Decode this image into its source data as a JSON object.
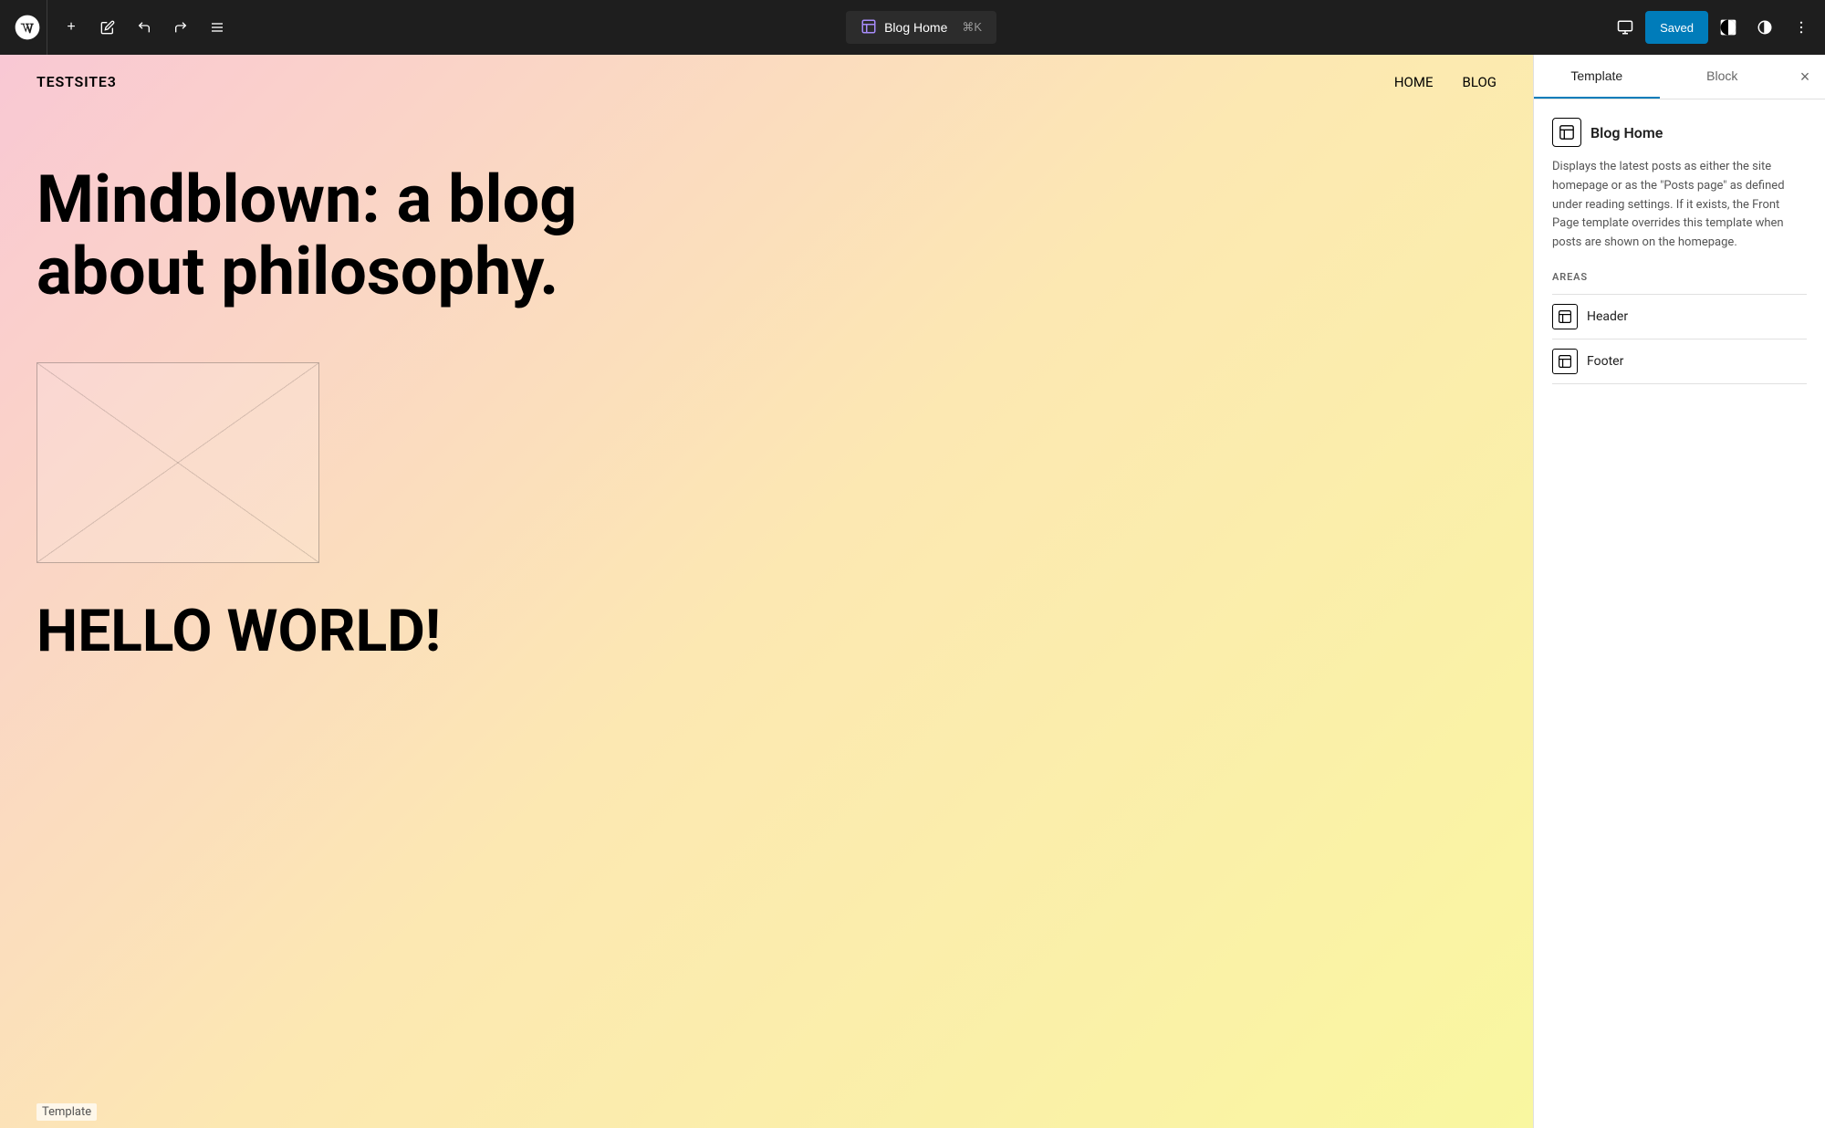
{
  "toolbar": {
    "add_label": "+",
    "undo_label": "↩",
    "redo_label": "↪",
    "list_view_label": "≡",
    "blog_home_label": "Blog Home",
    "shortcut": "⌘K",
    "device_preview_label": "□",
    "saved_label": "Saved",
    "contrast_label": "◑",
    "more_label": "⋮"
  },
  "canvas": {
    "site_title": "TESTSITE3",
    "nav_items": [
      "HOME",
      "BLOG"
    ],
    "blog_title": "Mindblown: a blog about philosophy.",
    "hello_world": "HELLO WORLD!",
    "bottom_label": "Template"
  },
  "sidebar": {
    "tab_template": "Template",
    "tab_block": "Block",
    "close_label": "×",
    "template_title": "Blog Home",
    "template_description": "Displays the latest posts as either the site homepage or as the \"Posts page\" as defined under reading settings. If it exists, the Front Page template overrides this template when posts are shown on the homepage.",
    "areas_label": "AREAS",
    "areas": [
      {
        "label": "Header"
      },
      {
        "label": "Footer"
      }
    ]
  },
  "colors": {
    "toolbar_bg": "#1e1e1e",
    "saved_btn": "#007cba",
    "template_tab_active": "#007cba",
    "canvas_gradient_start": "#f9c8d4",
    "canvas_gradient_mid": "#fce8b2",
    "canvas_gradient_end": "#f9f7a0"
  }
}
